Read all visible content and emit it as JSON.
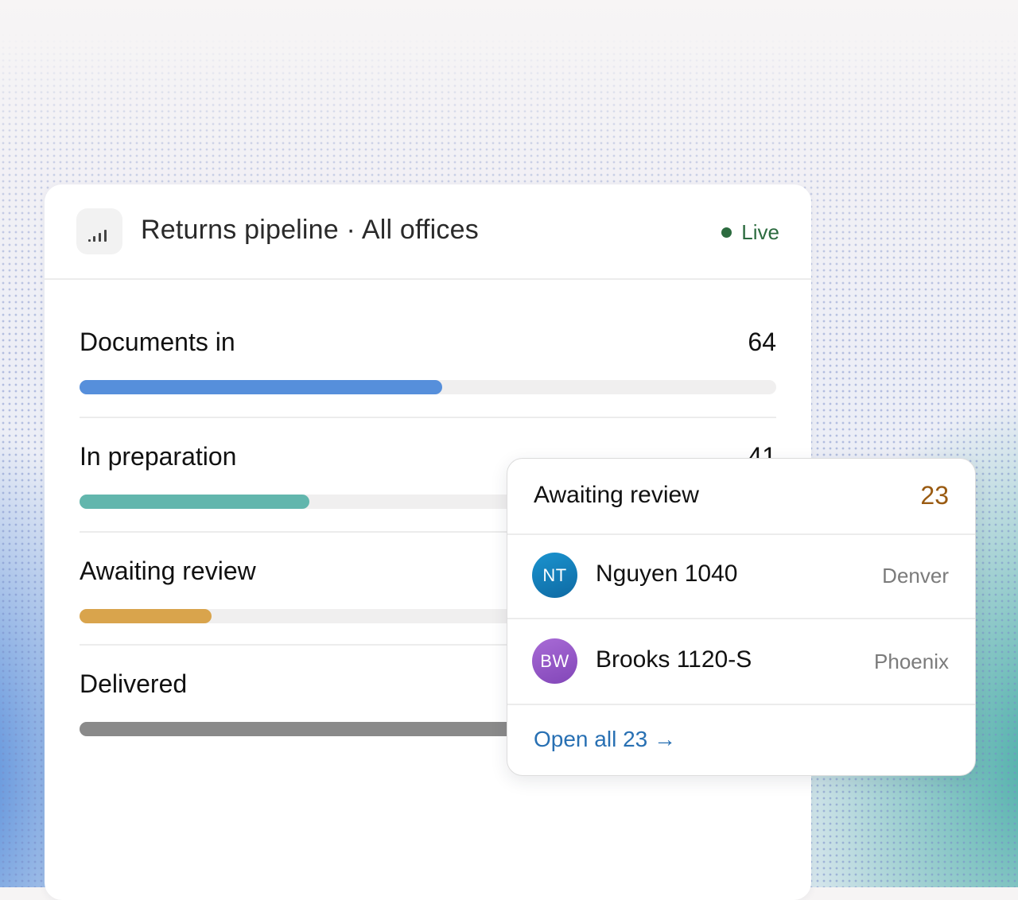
{
  "header": {
    "title": "Returns pipeline · All offices",
    "status": "Live",
    "icon": "bar-chart-icon"
  },
  "colors": {
    "live": "#2c6b3f",
    "documents_in": "#568fdb",
    "in_preparation": "#62b6ad",
    "awaiting_review": "#d9a44c",
    "delivered": "#8a8a8a",
    "link": "#2870b3",
    "review_count": "#9a5b12"
  },
  "stages": [
    {
      "label": "Documents in",
      "count": "64",
      "progress_fraction": 0.52
    },
    {
      "label": "In preparation",
      "count": "41",
      "progress_fraction": 0.33
    },
    {
      "label": "Awaiting review",
      "count": "23",
      "progress_fraction": 0.19
    },
    {
      "label": "Delivered",
      "count": "",
      "progress_fraction": 0.71
    }
  ],
  "popover": {
    "title": "Awaiting review",
    "count": "23",
    "items": [
      {
        "initials": "NT",
        "name": "Nguyen 1040",
        "office": "Denver"
      },
      {
        "initials": "BW",
        "name": "Brooks 1120-S",
        "office": "Phoenix"
      }
    ],
    "link": "Open all 23 →"
  }
}
